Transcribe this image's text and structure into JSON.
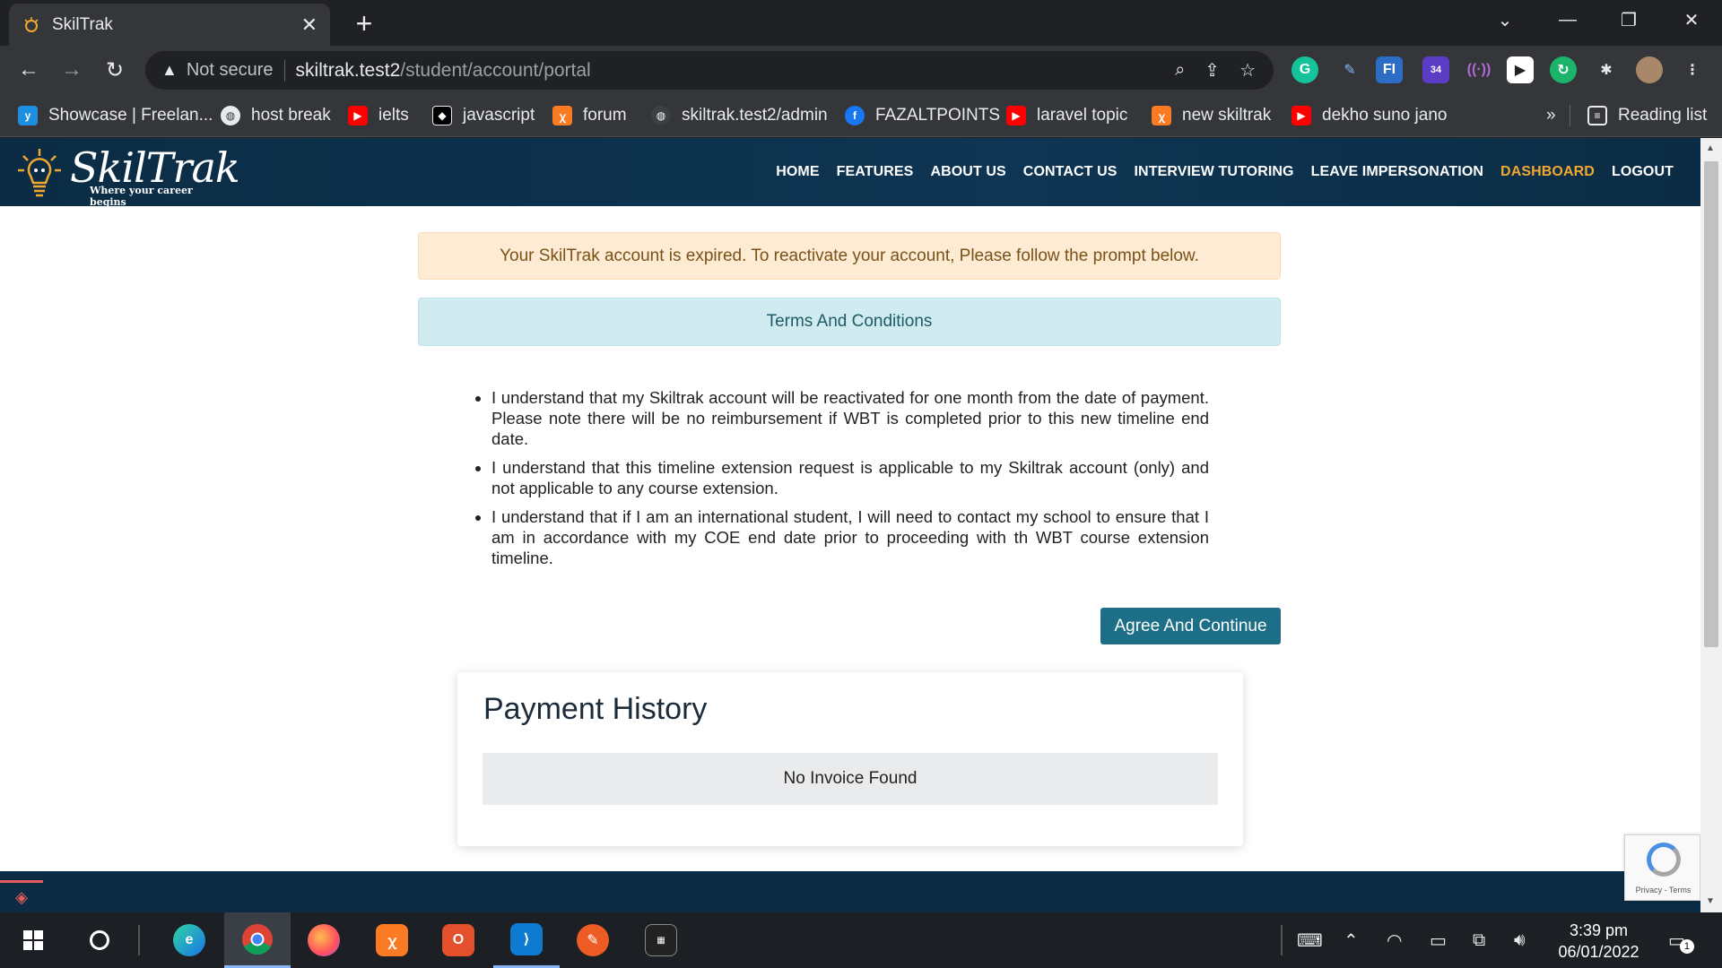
{
  "browser": {
    "tab_title": "SkilTrak",
    "tab_close": "✕",
    "new_tab": "+",
    "security_label": "Not secure",
    "url_host": "skiltrak.test2",
    "url_path": "/student/account/portal",
    "reading_list": "Reading list",
    "bookmarks_more": "»",
    "bookmarks": [
      {
        "label": "Showcase | Freelan...",
        "icon": "freelancer-icon",
        "color": "#1d8fe1"
      },
      {
        "label": "host break",
        "icon": "globe-icon",
        "color": "#5f6368"
      },
      {
        "label": "ielts",
        "icon": "youtube-icon",
        "color": "#ff0000"
      },
      {
        "label": "javascript",
        "icon": "codepen-icon",
        "color": "#000000"
      },
      {
        "label": "forum",
        "icon": "xampp-icon",
        "color": "#fb7a24"
      },
      {
        "label": "skiltrak.test2/admin",
        "icon": "globe-icon",
        "color": "#5f6368"
      },
      {
        "label": "FAZALTPOINTS",
        "icon": "facebook-icon",
        "color": "#1877f2"
      },
      {
        "label": "laravel topic",
        "icon": "youtube-icon",
        "color": "#ff0000"
      },
      {
        "label": "new skiltrak",
        "icon": "xampp-icon",
        "color": "#fb7a24"
      },
      {
        "label": "dekho suno jano",
        "icon": "youtube-icon",
        "color": "#ff0000"
      }
    ],
    "extension_badge": "34"
  },
  "site": {
    "logo_text": "SkilTrak",
    "logo_tagline": "Where your career begins",
    "nav": [
      {
        "label": "HOME",
        "active": false
      },
      {
        "label": "FEATURES",
        "active": false
      },
      {
        "label": "ABOUT US",
        "active": false
      },
      {
        "label": "CONTACT US",
        "active": false
      },
      {
        "label": "INTERVIEW TUTORING",
        "active": false
      },
      {
        "label": "LEAVE IMPERSONATION",
        "active": false
      },
      {
        "label": "DASHBOARD",
        "active": true
      },
      {
        "label": "LOGOUT",
        "active": false
      }
    ],
    "accent_color": "#f0a830"
  },
  "portal": {
    "expired_message": "Your SkilTrak account is expired. To reactivate your account, Please follow the prompt below.",
    "terms_heading": "Terms And Conditions",
    "terms": [
      "I understand that my Skiltrak account will be reactivated for one month from the date of payment. Please note there will be no reimbursement if WBT is completed prior to this new timeline end date.",
      "I understand that this timeline extension request is applicable to my Skiltrak account (only) and not applicable to any course extension.",
      "I understand that if I am an international student, I will need to contact my school to ensure that I am in accordance with my COE end date prior to proceeding with th WBT course extension timeline."
    ],
    "agree_button": "Agree And Continue",
    "payment_history_title": "Payment History",
    "no_invoice": "No Invoice Found"
  },
  "recaptcha": {
    "text": "Privacy - Terms"
  },
  "taskbar": {
    "time": "3:39 pm",
    "date": "06/01/2022",
    "notification_count": "1"
  }
}
